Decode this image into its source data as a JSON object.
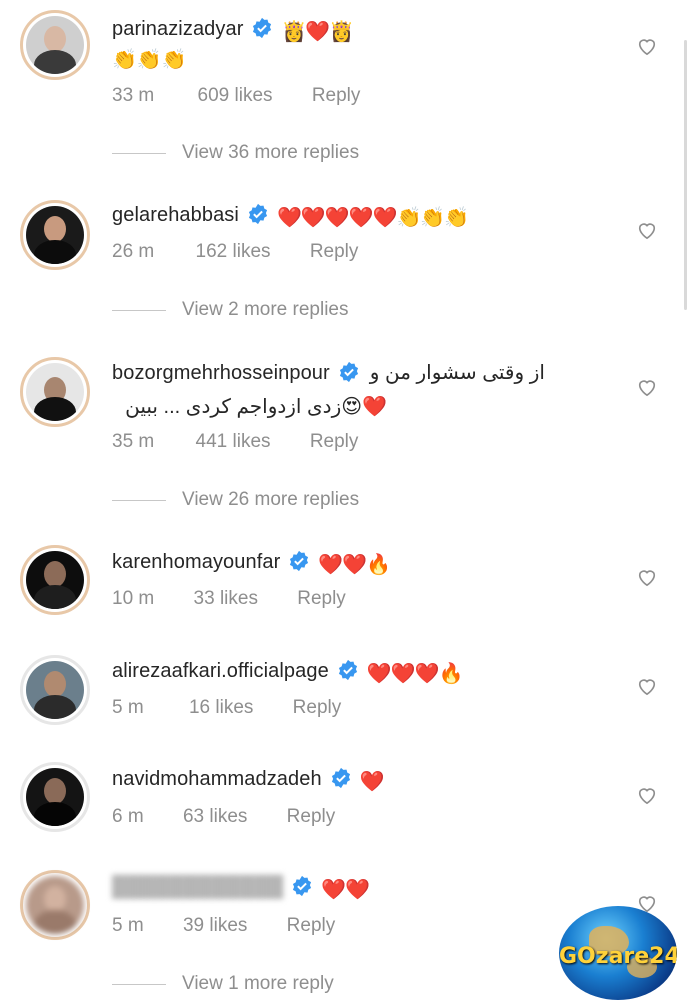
{
  "colors": {
    "text": "#262626",
    "secondary": "#8e8e8e",
    "verified": "#3897f0",
    "heart": "#e0112b"
  },
  "comments": [
    {
      "username": "parinazizadyar",
      "verified": true,
      "inline_emojis": "👸❤️👸",
      "line2": "👏👏👏",
      "time": "33 m",
      "likes": "609 likes",
      "reply": "Reply",
      "view_more": "View 36 more replies"
    },
    {
      "username": "gelarehabbasi",
      "verified": true,
      "inline_emojis": "❤️❤️❤️❤️❤️👏👏👏",
      "time": "26 m",
      "likes": "162 likes",
      "reply": "Reply",
      "view_more": "View 2 more replies"
    },
    {
      "username": "bozorgmehrhosseinpour",
      "verified": true,
      "text_line1": "از وقتی سشوار من و",
      "text_line2": "❤️😍زدی ازدواجم کردی ... ببین",
      "time": "35 m",
      "likes": "441 likes",
      "reply": "Reply",
      "view_more": "View 26 more replies"
    },
    {
      "username": "karenhomayounfar",
      "verified": true,
      "inline_emojis": "❤️❤️🔥",
      "time": "10 m",
      "likes": "33 likes",
      "reply": "Reply"
    },
    {
      "username": "alirezaafkari.officialpage",
      "verified": true,
      "inline_emojis": "❤️❤️❤️🔥",
      "time": "5 m",
      "likes": "16 likes",
      "reply": "Reply"
    },
    {
      "username": "navidmohammadzadeh",
      "verified": true,
      "inline_emojis": "❤️",
      "time": "6 m",
      "likes": "63 likes",
      "reply": "Reply"
    },
    {
      "username": "████████████",
      "verified": true,
      "inline_emojis": "❤️❤️",
      "time": "5 m",
      "likes": "39 likes",
      "reply": "Reply",
      "view_more": "View 1 more reply"
    }
  ],
  "watermark": "GOzare24"
}
